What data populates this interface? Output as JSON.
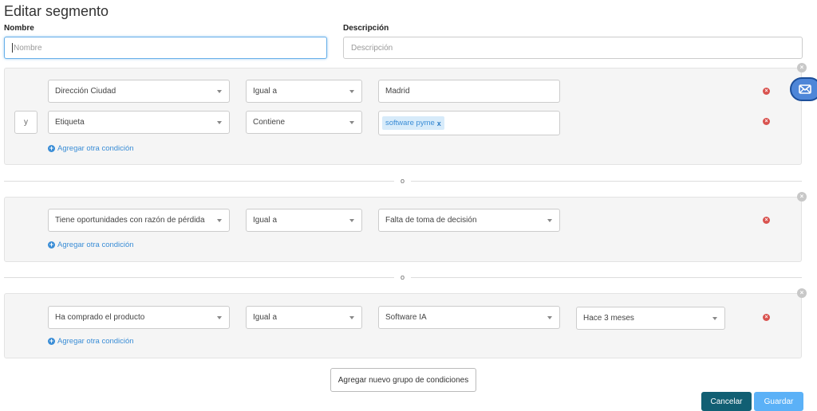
{
  "page": {
    "title": "Editar segmento"
  },
  "form": {
    "name_label": "Nombre",
    "name_placeholder": "Nombre",
    "desc_label": "Descripción",
    "desc_placeholder": "Descripción"
  },
  "groups": [
    {
      "conditions": [
        {
          "field": "Dirección Ciudad",
          "operator": "Igual a",
          "value": "Madrid"
        },
        {
          "connector": "y",
          "field": "Etiqueta",
          "operator": "Contiene",
          "tag": "software pyme",
          "tag_remove": "x"
        }
      ],
      "add_condition": "Agregar otra condición"
    },
    {
      "conditions": [
        {
          "field": "Tiene oportunidades con razón de pérdida",
          "operator": "Igual a",
          "value": "Falta de toma de decisión"
        }
      ],
      "add_condition": "Agregar otra condición"
    },
    {
      "conditions": [
        {
          "field": "Ha comprado el producto",
          "operator": "Igual a",
          "value": "Software IA",
          "period": "Hace 3 meses"
        }
      ],
      "add_condition": "Agregar otra condición"
    }
  ],
  "separators": [
    "o",
    "o"
  ],
  "actions": {
    "add_group": "Agregar nuevo grupo de condiciones",
    "cancel": "Cancelar",
    "save": "Guardar"
  },
  "icons": {
    "remove": "remove-circle-icon",
    "group_close": "close-circle-icon",
    "add": "plus-circle-icon",
    "caret": "caret-down-icon",
    "mail": "envelope-icon"
  },
  "colors": {
    "link": "#3a8dd6",
    "remove": "#d9534f",
    "cancel_bg": "#115f73",
    "save_bg": "#5bb1f7",
    "tag_bg": "#d7ebfa"
  }
}
